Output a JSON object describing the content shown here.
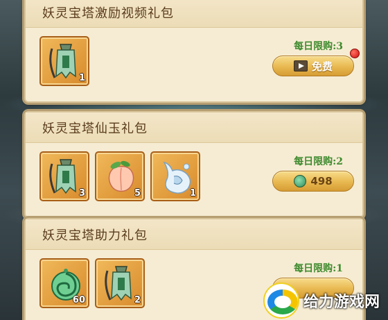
{
  "packs": [
    {
      "title": "妖灵宝塔激励视频礼包",
      "limit": "每日限购:3",
      "button": {
        "type": "video",
        "label": "免费"
      },
      "has_red_dot": true,
      "items": [
        {
          "icon": "green-banner-flag-icon",
          "count": "1"
        }
      ]
    },
    {
      "title": "妖灵宝塔仙玉礼包",
      "limit": "每日限购:2",
      "button": {
        "type": "jade",
        "label": "498"
      },
      "has_red_dot": false,
      "items": [
        {
          "icon": "green-banner-flag-icon",
          "count": "3"
        },
        {
          "icon": "peach-icon",
          "count": "5"
        },
        {
          "icon": "water-spirit-icon",
          "count": "1"
        }
      ]
    },
    {
      "title": "妖灵宝塔助力礼包",
      "limit": "每日限购:1",
      "button": {
        "type": "price",
        "label": ""
      },
      "has_red_dot": false,
      "items": [
        {
          "icon": "jade-dragon-pendant-icon",
          "count": "60"
        },
        {
          "icon": "green-banner-flag-icon",
          "count": "2"
        }
      ]
    }
  ],
  "watermark": {
    "text": "给力游戏网"
  },
  "colors": {
    "panel_bg": "#f6ecd3",
    "limit_text": "#3e8a2e",
    "button_gold": "#e8b850",
    "red_dot": "#d01010"
  }
}
